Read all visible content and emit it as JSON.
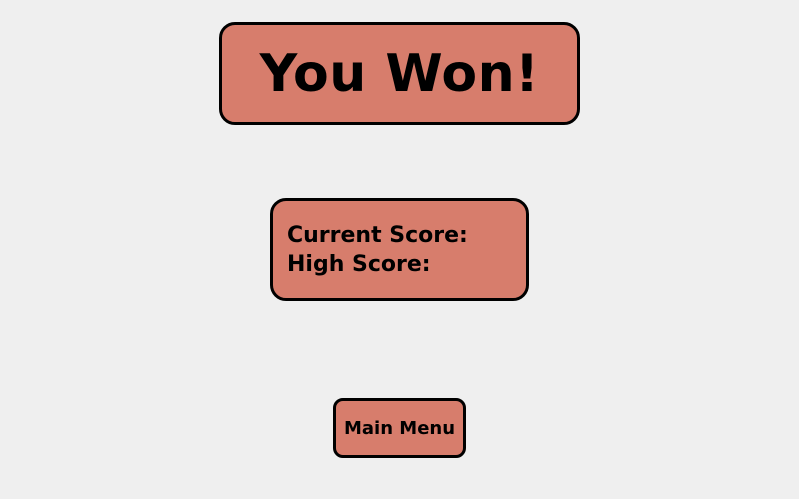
{
  "title": "You Won!",
  "scores": {
    "current_label": "Current Score:",
    "high_label": "High Score:"
  },
  "menu": {
    "main_menu_label": "Main Menu"
  },
  "colors": {
    "background": "#efefef",
    "panel": "#d77d6c",
    "border": "#000000"
  }
}
